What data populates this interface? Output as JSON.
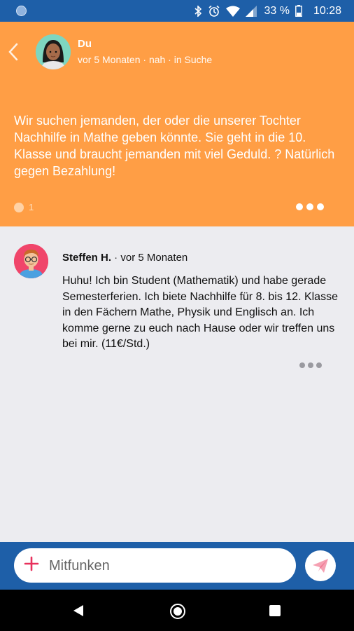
{
  "status_bar": {
    "battery_percent": "33 %",
    "time": "10:28"
  },
  "header": {
    "name": "Du",
    "meta": "vor 5 Monaten · nah · in Suche"
  },
  "post": {
    "text": "Wir suchen jemanden, der oder die unserer Tochter Nachhilfe in Mathe geben könnte. Sie geht in die 10. Klasse und braucht jemanden mit viel Geduld. ? Natürlich gegen Bezahlung!",
    "comment_count": "1"
  },
  "reply": {
    "author": "Steffen H.",
    "separator": " · ",
    "time": "vor 5 Monaten",
    "body": "Huhu! Ich bin Student (Mathematik) und habe gerade Semesterferien. Ich biete Nachhilfe für 8. bis 12. Klasse in den Fächern Mathe, Physik und Englisch an. Ich komme gerne zu euch nach Hause oder wir treffen uns bei mir. (11€/Std.)"
  },
  "composer": {
    "placeholder": "Mitfunken"
  },
  "colors": {
    "header_orange": "#ff9e45",
    "primary_blue": "#1e5fa8",
    "accent_pink": "#e8315c"
  },
  "icons": [
    "back-icon",
    "plus-icon",
    "send-icon",
    "bluetooth-icon",
    "alarm-icon",
    "wifi-icon",
    "signal-icon",
    "battery-icon"
  ]
}
